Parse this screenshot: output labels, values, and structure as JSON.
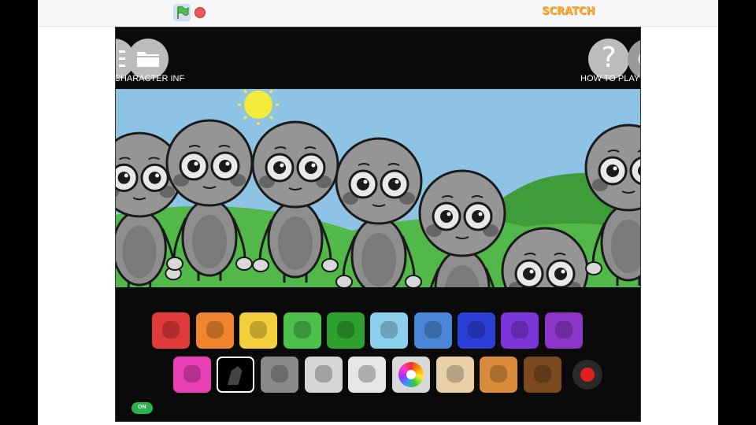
{
  "header": {
    "logo_text": "SCRATCH",
    "green_flag_icon": "green-flag-icon",
    "stop_icon": "stop-sign-icon"
  },
  "game": {
    "character_info_label": "CHARACTER INFO",
    "how_to_play_label": "HOW TO PLAY",
    "help_glyph": "?",
    "toggle_label": "ON"
  },
  "palette": {
    "row1": [
      {
        "name": "red-blob",
        "color": "#e13a3a"
      },
      {
        "name": "orange-paw",
        "color": "#f0852d"
      },
      {
        "name": "yellow-honeycomb",
        "color": "#f3d03b"
      },
      {
        "name": "green-hat",
        "color": "#4cbf4c"
      },
      {
        "name": "dark-green-frog",
        "color": "#2ea02e"
      },
      {
        "name": "light-blue-crystal",
        "color": "#8ccfea"
      },
      {
        "name": "blue-drop",
        "color": "#4a86d8"
      },
      {
        "name": "dark-blue-gem",
        "color": "#2b3fd6"
      },
      {
        "name": "purple-orb",
        "color": "#7b35d8"
      },
      {
        "name": "violet-feather",
        "color": "#8b36c8"
      }
    ],
    "row2": [
      {
        "name": "magenta-tablet",
        "color": "#e93fb5"
      },
      {
        "name": "black-crystal",
        "color": "#1a1a1a",
        "selected": true
      },
      {
        "name": "gray-paw",
        "color": "#8a8a8a"
      },
      {
        "name": "white-stone",
        "color": "#d6d6d6"
      },
      {
        "name": "white-fern",
        "color": "#e6e6e6"
      },
      {
        "name": "rainbow-flower",
        "color": "#f2f2f2"
      },
      {
        "name": "beige-horn",
        "color": "#e9cfa7"
      },
      {
        "name": "tan-seed",
        "color": "#d98d3b"
      },
      {
        "name": "brown-paw",
        "color": "#7a4a1e"
      },
      {
        "name": "record-dot",
        "color": "#e02020"
      }
    ]
  }
}
